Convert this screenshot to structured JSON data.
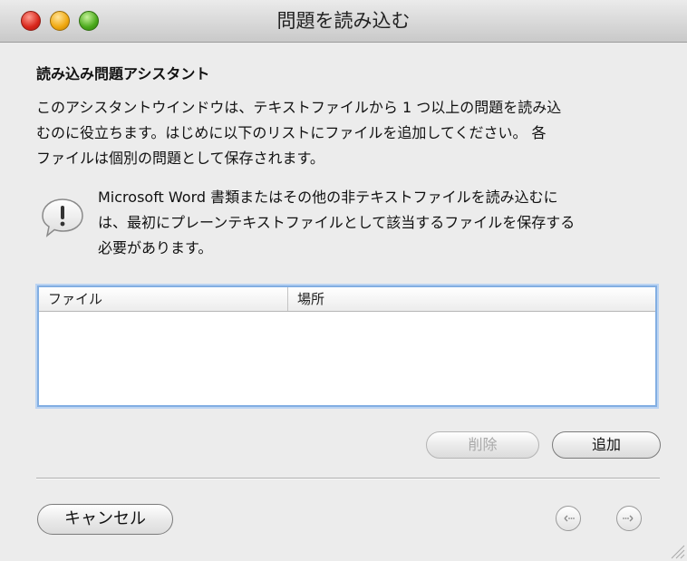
{
  "window": {
    "title": "問題を読み込む"
  },
  "assistant": {
    "heading": "読み込み問題アシスタント",
    "intro_lines": [
      "このアシスタントウインドウは、テキストファイルから 1 つ以上の問題を読み込",
      "むのに役立ちます。はじめに以下のリストにファイルを追加してください。 各",
      "ファイルは個別の問題として保存されます。"
    ],
    "note_lines": [
      "Microsoft Word 書類またはその他の非テキストファイルを読み込むに",
      "は、最初にプレーンテキストファイルとして該当するファイルを保存する",
      "必要があります。"
    ],
    "note_icon": "exclamation-speech-bubble-icon"
  },
  "file_list": {
    "columns": [
      "ファイル",
      "場所"
    ],
    "rows": []
  },
  "buttons": {
    "delete": "削除",
    "add": "追加",
    "cancel": "キャンセル"
  },
  "navigation": {
    "back_icon": "back-arrow-icon",
    "forward_icon": "forward-arrow-icon"
  },
  "colors": {
    "focus_ring": "#82aee2",
    "close": "#d8261b",
    "minimize": "#f0a80f",
    "zoom": "#4aa91b"
  }
}
